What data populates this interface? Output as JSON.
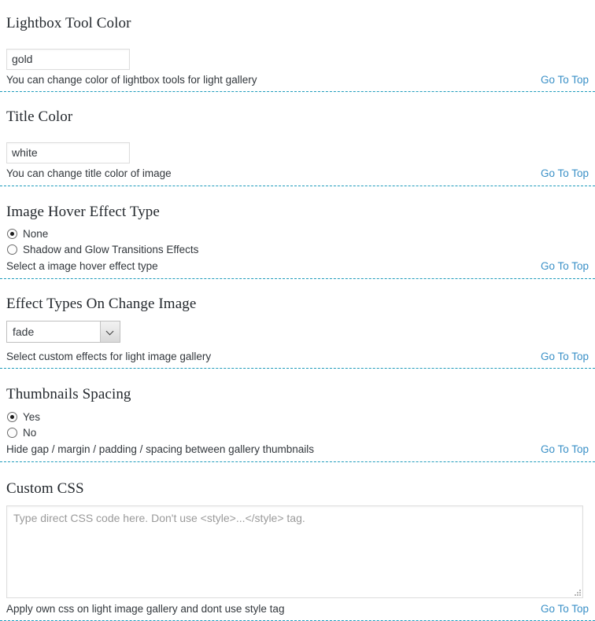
{
  "theme": {
    "link_color": "#3a90c7",
    "divider_color": "#1e9bbb",
    "heading_color": "#23282d",
    "text_color": "#32373c",
    "placeholder_color": "#9a9a9a"
  },
  "goto_top_label": "Go To Top",
  "sections": {
    "lightbox_tool_color": {
      "heading": "Lightbox Tool Color",
      "value": "gold",
      "description": "You can change color of lightbox tools for light gallery"
    },
    "title_color": {
      "heading": "Title Color",
      "value": "white",
      "description": "You can change title color of image"
    },
    "image_hover_effect_type": {
      "heading": "Image Hover Effect Type",
      "options": [
        {
          "label": "None",
          "checked": true
        },
        {
          "label": "Shadow and Glow Transitions Effects",
          "checked": false
        }
      ],
      "description": "Select a image hover effect type"
    },
    "effect_types_on_change_image": {
      "heading": "Effect Types On Change Image",
      "selected": "fade",
      "description": "Select custom effects for light image gallery"
    },
    "thumbnails_spacing": {
      "heading": "Thumbnails Spacing",
      "options": [
        {
          "label": "Yes",
          "checked": true
        },
        {
          "label": "No",
          "checked": false
        }
      ],
      "description": "Hide gap / margin / padding / spacing between gallery thumbnails"
    },
    "custom_css": {
      "heading": "Custom CSS",
      "value": "",
      "placeholder": "Type direct CSS code here. Don't use <style>...</style> tag.",
      "description": "Apply own css on light image gallery and dont use style tag"
    }
  }
}
